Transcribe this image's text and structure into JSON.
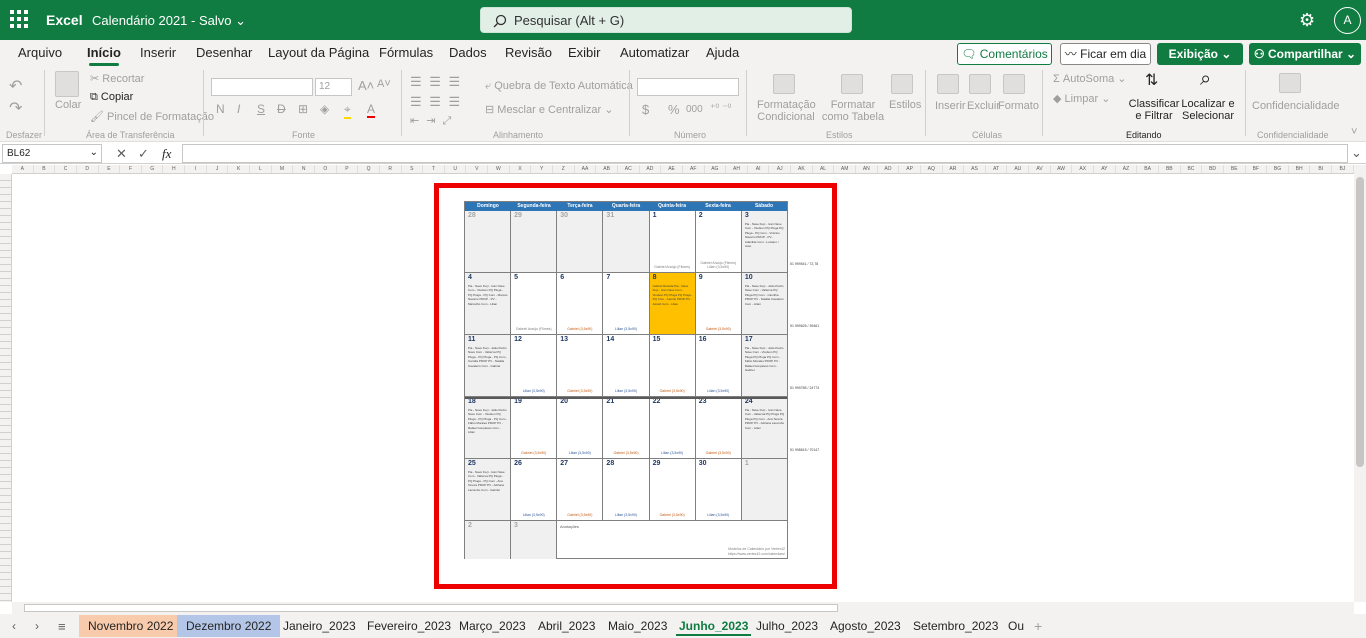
{
  "title_bar": {
    "app_name": "Excel",
    "doc_name": "Calendário 2021  -  Salvo",
    "search_placeholder": "Pesquisar (Alt + G)",
    "avatar_initial": "A"
  },
  "menu": {
    "items": [
      "Arquivo",
      "Início",
      "Inserir",
      "Desenhar",
      "Layout da Página",
      "Fórmulas",
      "Dados",
      "Revisão",
      "Exibir",
      "Automatizar",
      "Ajuda"
    ],
    "active": "Início",
    "comments_label": "Comentários",
    "meeting_label": "Ficar em dia",
    "view_label": "Exibição",
    "share_label": "Compartilhar"
  },
  "ribbon": {
    "undo_group": "Desfazer",
    "clipboard": {
      "paste": "Colar",
      "cut": "Recortar",
      "copy": "Copiar",
      "format_painter": "Pincel de Formatação",
      "group": "Área de Transferência"
    },
    "font": {
      "size": "12",
      "bold": "N",
      "italic": "I",
      "underline": "S",
      "strike": "D",
      "group": "Fonte"
    },
    "alignment": {
      "wrap": "Quebra de Texto Automática",
      "merge": "Mesclar e Centralizar",
      "group": "Alinhamento"
    },
    "number": {
      "currency": "$",
      "percent": "%",
      "thousands": "000",
      "group": "Número"
    },
    "styles": {
      "conditional": "Formatação Condicional",
      "table": "Formatar como Tabela",
      "cell_styles": "Estilos",
      "group": "Estilos"
    },
    "cells": {
      "insert": "Inserir",
      "delete": "Excluir",
      "format": "Formato",
      "group": "Células"
    },
    "editing": {
      "autosum": "AutoSoma",
      "clear": "Limpar",
      "sort": "Classificar e Filtrar",
      "find": "Localizar e Selecionar",
      "group": "Editando"
    },
    "sensitivity": {
      "label": "Confidencialidade",
      "group": "Confidencialidade"
    }
  },
  "formula_bar": {
    "name_box": "BL62",
    "fx": "fx"
  },
  "calendar": {
    "day_headers": [
      "Domingo",
      "Segunda-feira",
      "Terça-feira",
      "Quarta-feira",
      "Quinta-feira",
      "Sexta-feira",
      "Sábado"
    ],
    "weeks": [
      {
        "days": [
          "28",
          "29",
          "30",
          "31",
          "1",
          "2",
          "3"
        ],
        "notes": [
          "",
          "",
          "",
          "",
          "Gabriel Araújo (Filmes)",
          "Gabriel Araújo (Filmes)  Lilian (3,5x90)",
          "Pia -  Nave Fuçi - Ivan  Nave Com - Viudson  PQ Pluga  PQ Pluga -  PQ Com - Vinicius Navarro  PROP -  PV - Adanilde  Com - Luciano / José"
        ],
        "side_code": "51 999541 / 72,78"
      },
      {
        "days": [
          "4",
          "5",
          "6",
          "7",
          "8",
          "9",
          "10"
        ],
        "notes": [
          "Pia -  Nave Fuçi - Ivan  Nave Com - Viudson  PQ Pluga -  PQ Pluga -  PQ Com - Marcos Navarro  PROP -  PV - Marcelho  Com - Lilian",
          "Gabriel Araújo (Filmes)",
          "Gabriel (3,5x90)",
          "Lilian (3,5x90)",
          "Gabriel Rosada  Pia -  Nave Fuçi - Ivan  Nave Com - Viudson  PQ Pluga  PQ Pluga -  PQ Com - Camilo  PROP  PV - Adnah  Com - Lilian",
          "Gabriel (3,5x90)",
          "Pia -  Nave Fuçi - João Pedro  Nave Com - Valterva  PQ Pluga  PQ Com - Camilha  PROP  PV - Natália Cavaleiro  Com - Lilian"
        ],
        "side_code": "51 999626 / 39461"
      },
      {
        "days": [
          "11",
          "12",
          "13",
          "14",
          "15",
          "16",
          "17"
        ],
        "notes": [
          "Pia -  Nave Fuçi - João Pedro  Nave Com - Valterva  PQ Pluga -  PQ Pluga -  PQ Com - Camilla  PROP  PV - Natália Cavaleiro  Com - Gabriel",
          "Lilian (3,5x90)",
          "Gabriel (3,5x90)",
          "Lilian (3,5x90)",
          "Gabriel (3,5x90)",
          "Lilian (3,5x90)",
          "Pia -  Nave Fuçi - João Pedro  Nave Com - Viudson  PQ Pluga  PQ Pluga  PQ Com - Fábio Morales  PROP  PV - Rafael Gonçalves  Com - Gabriel"
        ],
        "side_code": "51 999785 / 24774"
      },
      {
        "days": [
          "18",
          "19",
          "20",
          "21",
          "22",
          "23",
          "24"
        ],
        "notes": [
          "Pia -  Nave Fuçi - João Pedro  Nave Com - Viudson  PQ Pluga -  PQ Pluga -  PQ Com - Fábio Morales  PROP  PV - Rafael Gonçalves  Com - Lilian",
          "Gabriel (3,5x90)",
          "Lilian (3,5x90)",
          "Gabriel (3,5x90)",
          "Lilian (3,5x90)",
          "Gabriel (3,5x90)",
          "Pia -  Nave Fuçi - Ivan  Nave Com - Valterval  PQ Pluga  PQ Pluga  PQ Com - Ana Tereza  PROP  PV - Adriana Lacombo  Com - Lilian"
        ],
        "side_code": "51 998615 / 70147"
      },
      {
        "days": [
          "25",
          "26",
          "27",
          "28",
          "29",
          "30",
          "1"
        ],
        "notes": [
          "Pia -  Nave Fuçi - Ivan  Nave Com - Valterva  PQ Pluga -  PQ Pluga -  PQ Com - Ana Tereza  PROP  PV - Adriana Lacombo  Com - Gabriel",
          "Lilian (3,5x90)",
          "Gabriel (3,5x90)",
          "Lilian (3,5x90)",
          "Gabriel (3,5x90)",
          "Lilian (3,5x90)",
          ""
        ],
        "side_code": ""
      }
    ],
    "last_row": {
      "days": [
        "2",
        "3"
      ],
      "annotations_label": "Anotações",
      "credit_line1": "Modelos de Calendário por Vertex42",
      "credit_line2": "https://www.vertex42.com/calendars/"
    },
    "highlight_color": "#ffc000",
    "header_color": "#2e75b6"
  },
  "sheet_tabs": {
    "tabs": [
      "Novembro 2022",
      "Dezembro 2022",
      "Janeiro_2023",
      "Fevereiro_2023",
      "Março_2023",
      "Abril_2023",
      "Maio_2023",
      "Junho_2023",
      "Julho_2023",
      "Agosto_2023",
      "Setembro_2023",
      "Ou"
    ],
    "active": "Junho_2023",
    "tab_colors": {
      "Novembro 2022": "#f8cbad",
      "Dezembro 2022": "#b4c6e7"
    }
  },
  "colors": {
    "accent": "#107c41",
    "selection_frame": "#e00000"
  }
}
